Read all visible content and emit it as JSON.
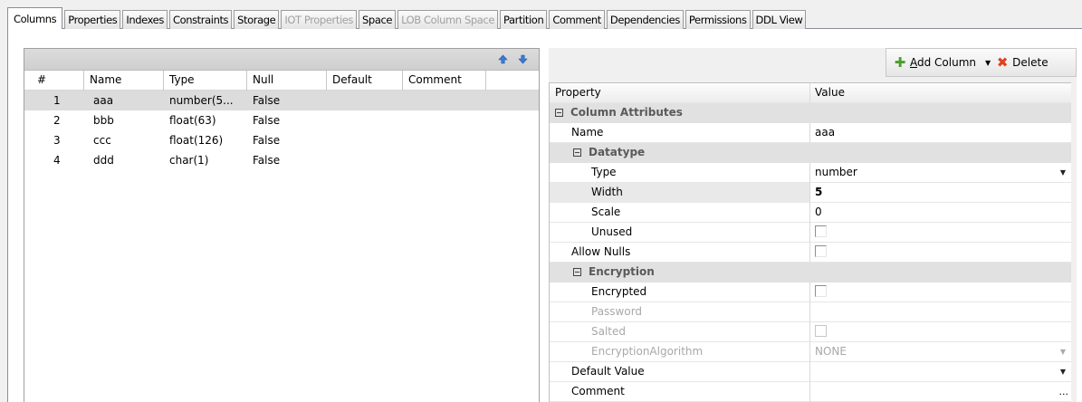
{
  "tabs": [
    {
      "label": "Columns",
      "state": "active"
    },
    {
      "label": "Properties",
      "state": "normal"
    },
    {
      "label": "Indexes",
      "state": "normal"
    },
    {
      "label": "Constraints",
      "state": "normal"
    },
    {
      "label": "Storage",
      "state": "normal"
    },
    {
      "label": "IOT Properties",
      "state": "disabled"
    },
    {
      "label": "Space",
      "state": "normal"
    },
    {
      "label": "LOB Column Space",
      "state": "disabled"
    },
    {
      "label": "Partition",
      "state": "normal"
    },
    {
      "label": "Comment",
      "state": "normal"
    },
    {
      "label": "Dependencies",
      "state": "normal"
    },
    {
      "label": "Permissions",
      "state": "normal"
    },
    {
      "label": "DDL View",
      "state": "normal"
    }
  ],
  "columns_grid": {
    "move_up_icon": "arrow-up-icon",
    "move_down_icon": "arrow-down-icon",
    "headers": [
      "#",
      "Name",
      "Type",
      "Null",
      "Default",
      "Comment"
    ],
    "rows": [
      {
        "num": "1",
        "name": "aaa",
        "type": "number(5...",
        "null": "False",
        "default": "",
        "comment": ""
      },
      {
        "num": "2",
        "name": "bbb",
        "type": "float(63)",
        "null": "False",
        "default": "",
        "comment": ""
      },
      {
        "num": "3",
        "name": "ccc",
        "type": "float(126)",
        "null": "False",
        "default": "",
        "comment": ""
      },
      {
        "num": "4",
        "name": "ddd",
        "type": "char(1)",
        "null": "False",
        "default": "",
        "comment": ""
      }
    ],
    "selected_row": 0
  },
  "toolbar": {
    "add_column_label": "Add Column",
    "delete_label": "Delete"
  },
  "property_grid": {
    "header_property": "Property",
    "header_value": "Value",
    "column_attributes_label": "Column Attributes",
    "name_label": "Name",
    "name_value": "aaa",
    "datatype_label": "Datatype",
    "type_label": "Type",
    "type_value": "number",
    "width_label": "Width",
    "width_value": "5",
    "scale_label": "Scale",
    "scale_value": "0",
    "unused_label": "Unused",
    "allow_nulls_label": "Allow Nulls",
    "encryption_label": "Encryption",
    "encrypted_label": "Encrypted",
    "password_label": "Password",
    "salted_label": "Salted",
    "encryption_algorithm_label": "EncryptionAlgorithm",
    "encryption_algorithm_value": "NONE",
    "default_value_label": "Default Value",
    "comment_label": "Comment",
    "comment_button": "..."
  },
  "colors": {
    "plus_icon": "#4a9f2e",
    "delete_icon": "#e04020",
    "arrow_icon": "#3a7bd5"
  }
}
